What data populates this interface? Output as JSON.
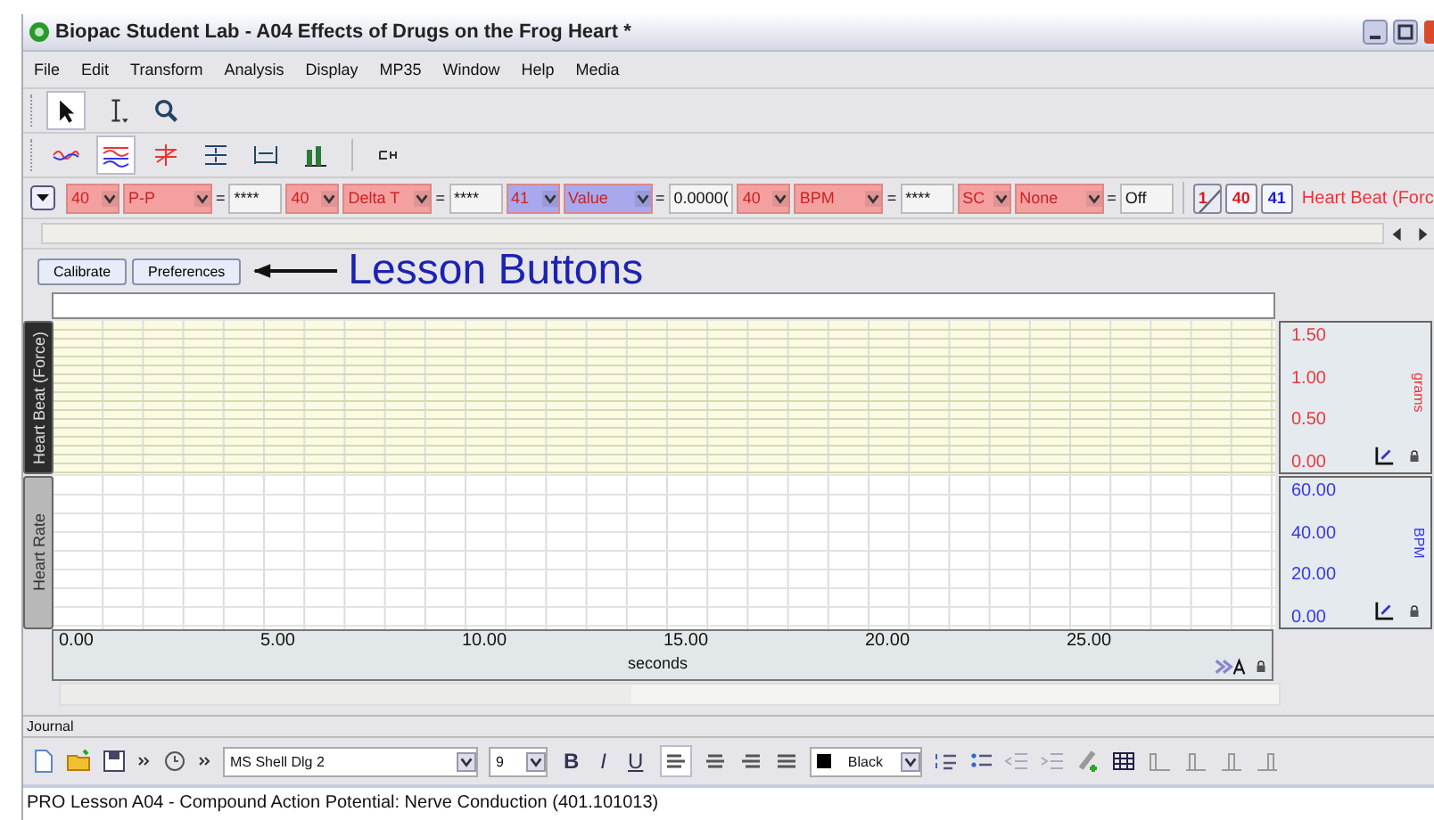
{
  "window": {
    "title": "Biopac Student Lab - A04 Effects of Drugs on the Frog Heart *"
  },
  "menu": [
    "File",
    "Edit",
    "Transform",
    "Analysis",
    "Display",
    "MP35",
    "Window",
    "Help",
    "Media"
  ],
  "measurements": [
    {
      "channel": "40",
      "function": "P-P",
      "equals": "=",
      "result": "****",
      "color": "#f4a0a0"
    },
    {
      "channel": "40",
      "function": "Delta T",
      "equals": "=",
      "result": "****",
      "color": "#f4a0a0"
    },
    {
      "channel": "41",
      "function": "Value",
      "equals": "=",
      "result": "0.0000(",
      "color": "#a8a8ee"
    },
    {
      "channel": "40",
      "function": "BPM",
      "equals": "=",
      "result": "****",
      "color": "#f4a0a0"
    },
    {
      "channel": "SC",
      "function": "None",
      "equals": "=",
      "result": "Off",
      "color": "#f4a0a0"
    }
  ],
  "channel_buttons": [
    {
      "label": "1",
      "visible": false,
      "color": "#e01818"
    },
    {
      "label": "40",
      "visible": true,
      "color": "#e01818"
    },
    {
      "label": "41",
      "visible": true,
      "color": "#1818d0"
    }
  ],
  "channel_title": "Heart Beat (Forc",
  "lesson_buttons": [
    "Calibrate",
    "Preferences"
  ],
  "annotation": "Lesson Buttons",
  "channels": [
    {
      "label": "Heart Beat (Force)",
      "selected": true,
      "color": "#e8383c",
      "scale": [
        "1.50",
        "1.00",
        "0.50",
        "0.00"
      ],
      "unit": "grams"
    },
    {
      "label": "Heart Rate",
      "selected": false,
      "color": "#3838e0",
      "scale": [
        "60.00",
        "40.00",
        "20.00",
        "0.00"
      ],
      "unit": "BPM"
    }
  ],
  "x_axis": {
    "ticks": [
      "0.00",
      "5.00",
      "10.00",
      "15.00",
      "20.00",
      "25.00"
    ],
    "label": "seconds"
  },
  "journal": {
    "label": "Journal",
    "font": "MS Shell Dlg 2",
    "size": "9",
    "format": [
      "B",
      "I",
      "U"
    ],
    "color_label": "Black",
    "text": "PRO Lesson A04 - Compound Action Potential: Nerve Conduction (401.101013)"
  }
}
